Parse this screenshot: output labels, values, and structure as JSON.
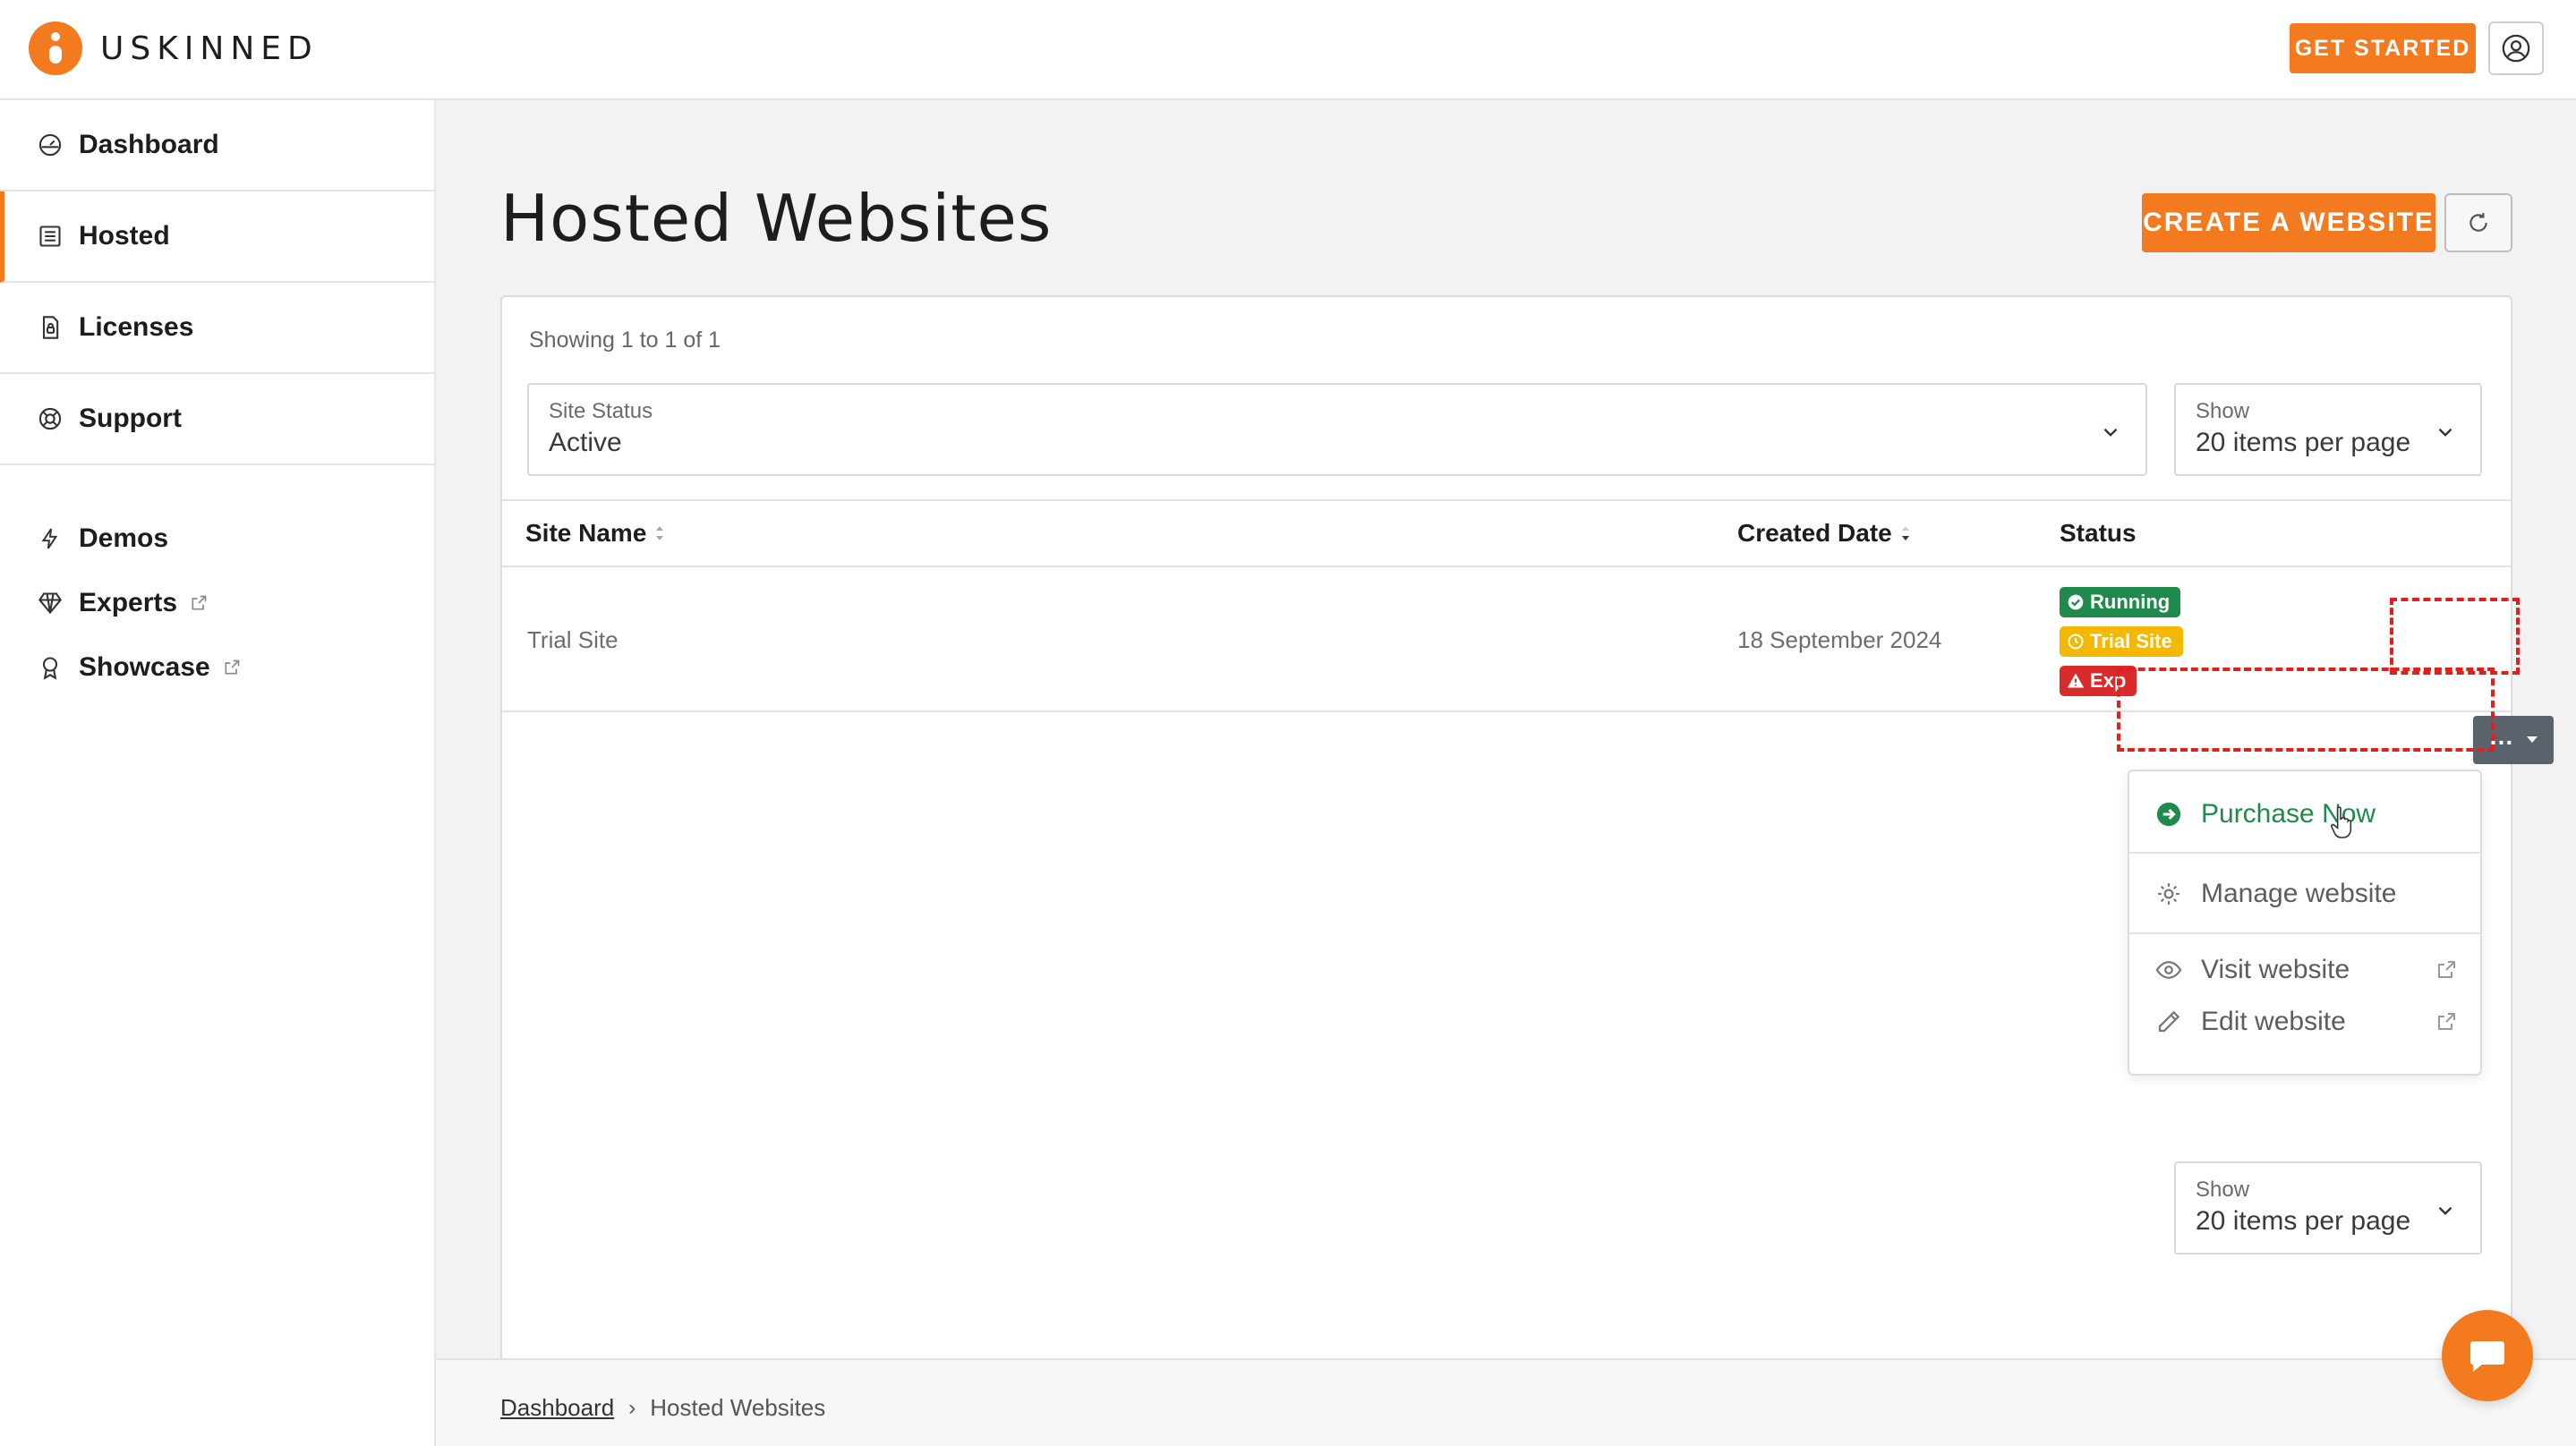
{
  "brand": {
    "name": "USKINNED",
    "accent": "#f47a20"
  },
  "header": {
    "get_started_label": "GET STARTED"
  },
  "sidebar": {
    "items": [
      {
        "label": "Dashboard",
        "icon": "dashboard-icon"
      },
      {
        "label": "Hosted",
        "icon": "hosted-icon",
        "active": true
      },
      {
        "label": "Licenses",
        "icon": "license-icon"
      },
      {
        "label": "Support",
        "icon": "support-icon"
      }
    ],
    "secondary": [
      {
        "label": "Demos",
        "icon": "bolt-icon"
      },
      {
        "label": "Experts",
        "icon": "gem-icon",
        "external": true
      },
      {
        "label": "Showcase",
        "icon": "award-icon",
        "external": true
      }
    ]
  },
  "main": {
    "title": "Hosted Websites",
    "create_label": "CREATE A WEBSITE",
    "showing": "Showing 1 to 1 of 1",
    "filters": {
      "site_status": {
        "label": "Site Status",
        "value": "Active"
      },
      "show": {
        "label": "Show",
        "value": "20 items per page"
      }
    },
    "table": {
      "columns": [
        "Site Name",
        "Created Date",
        "Status"
      ],
      "rows": [
        {
          "site_name": "Trial Site",
          "created_date": "18 September 2024",
          "badges": [
            {
              "label": "Running",
              "color": "#1e8a4c"
            },
            {
              "label": "Trial Site",
              "color": "#f5b800"
            },
            {
              "label": "Exp",
              "color": "#d92b2b"
            }
          ]
        }
      ]
    },
    "actions_menu": {
      "items": [
        {
          "label": "Purchase Now",
          "icon": "arrow-circle-icon",
          "color": "#1e8a4c"
        },
        {
          "label": "Manage website",
          "icon": "gear-icon"
        },
        {
          "label": "Visit website",
          "icon": "eye-icon",
          "external": true
        },
        {
          "label": "Edit website",
          "icon": "pencil-icon",
          "external": true
        }
      ]
    },
    "bottom_show": {
      "label": "Show",
      "value": "20 items per page"
    }
  },
  "breadcrumb": {
    "home": "Dashboard",
    "current": "Hosted Websites"
  }
}
